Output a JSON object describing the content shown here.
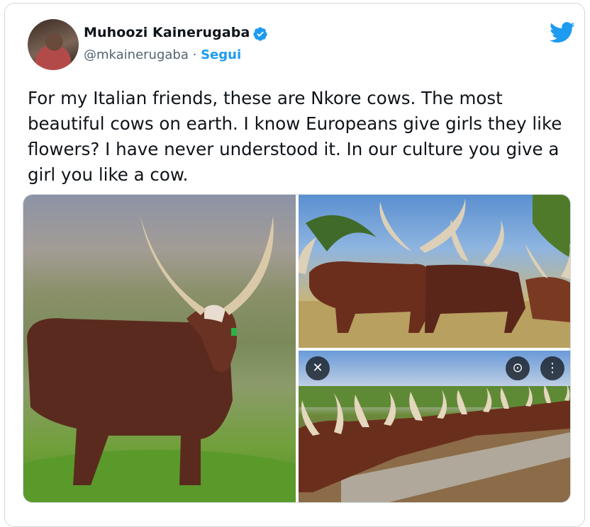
{
  "author": {
    "display_name": "Muhoozi Kainerugaba",
    "handle": "@mkainerugaba",
    "separator": "·",
    "follow_label": "Segui",
    "verified": true,
    "verified_color": "#1d9bf0"
  },
  "tweet": {
    "text": "For my Italian friends, these are Nkore cows. The most beautiful cows on earth. I know Europeans give girls they like flowers? I have never understood it. In our culture you give a girl you like a cow."
  },
  "media": {
    "photo_count": 3,
    "overlay_icons": [
      "close-icon",
      "lens-icon",
      "more-icon"
    ]
  },
  "brand": {
    "logo": "twitter-bird-icon",
    "color": "#1d9bf0"
  }
}
